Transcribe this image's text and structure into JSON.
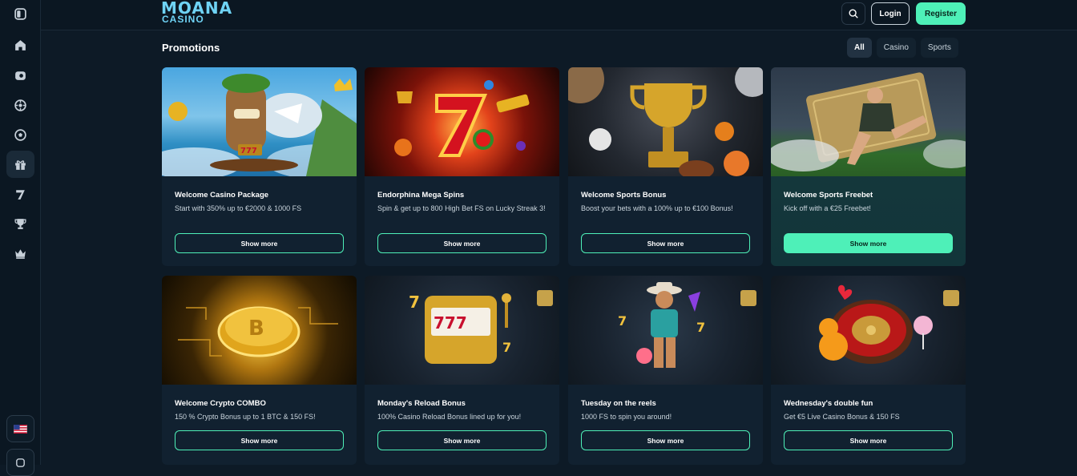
{
  "brand": {
    "logo_top": "MOANA",
    "logo_bottom": "CASINO"
  },
  "header": {
    "login": "Login",
    "register": "Register"
  },
  "page_title": "Promotions",
  "filters": [
    "All",
    "Casino",
    "Sports"
  ],
  "sidebar": {
    "items": [
      "toggle-sidebar-icon",
      "home-icon",
      "casino-chip-icon",
      "roulette-icon",
      "football-icon",
      "gift-icon",
      "seven-icon",
      "trophy-icon",
      "crown-icon"
    ],
    "language": "en-US flag"
  },
  "cards": [
    {
      "title": "Welcome Casino Package",
      "desc": "Start with 350% up to €2000 & 1000 FS",
      "button": "Show more"
    },
    {
      "title": "Endorphina Mega Spins",
      "desc": "Spin & get up to 800 High Bet FS on Lucky Streak 3!",
      "button": "Show more"
    },
    {
      "title": "Welcome Sports Bonus",
      "desc": "Boost your bets with a 100% up to €100 Bonus!",
      "button": "Show more"
    },
    {
      "title": "Welcome Sports Freebet",
      "desc": "Kick off with a €25 Freebet!",
      "button": "Show more"
    },
    {
      "title": "Welcome Crypto COMBO",
      "desc": "150 % Crypto Bonus up to 1 BTC & 150 FS!",
      "button": "Show more"
    },
    {
      "title": "Monday's Reload Bonus",
      "desc": "100% Casino Reload Bonus lined up for you!",
      "button": "Show more"
    },
    {
      "title": "Tuesday on the reels",
      "desc": "1000 FS to spin you around!",
      "button": "Show more"
    },
    {
      "title": "Wednesday's double fun",
      "desc": "Get €5 Live Casino Bonus & 150 FS",
      "button": "Show more"
    }
  ],
  "colors": {
    "accent": "#4ef0b8",
    "bg": "#0d1a26",
    "card": "#112130"
  }
}
